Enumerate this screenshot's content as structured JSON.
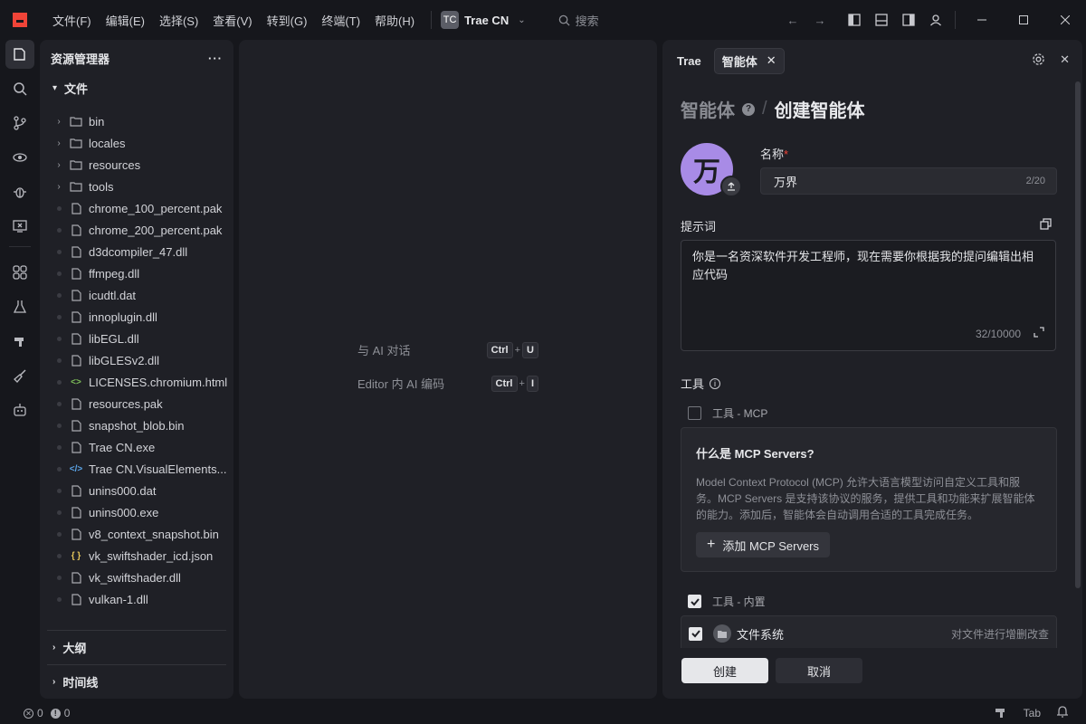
{
  "menu": [
    "文件(F)",
    "编辑(E)",
    "选择(S)",
    "查看(V)",
    "转到(G)",
    "终端(T)",
    "帮助(H)"
  ],
  "project": {
    "badge": "TC",
    "name": "Trae CN"
  },
  "search": {
    "placeholder": "搜索"
  },
  "explorer": {
    "title": "资源管理器",
    "more": "···",
    "folder": "文件",
    "folders": [
      "bin",
      "locales",
      "resources",
      "tools"
    ],
    "files": [
      {
        "name": "chrome_100_percent.pak",
        "icon": "file-icon"
      },
      {
        "name": "chrome_200_percent.pak",
        "icon": "file-icon"
      },
      {
        "name": "d3dcompiler_47.dll",
        "icon": "file-icon"
      },
      {
        "name": "ffmpeg.dll",
        "icon": "file-icon"
      },
      {
        "name": "icudtl.dat",
        "icon": "file-icon"
      },
      {
        "name": "innoplugin.dll",
        "icon": "file-icon"
      },
      {
        "name": "libEGL.dll",
        "icon": "file-icon"
      },
      {
        "name": "libGLESv2.dll",
        "icon": "file-icon"
      },
      {
        "name": "LICENSES.chromium.html",
        "icon": "html-icon"
      },
      {
        "name": "resources.pak",
        "icon": "file-icon"
      },
      {
        "name": "snapshot_blob.bin",
        "icon": "file-icon"
      },
      {
        "name": "Trae CN.exe",
        "icon": "file-icon"
      },
      {
        "name": "Trae CN.VisualElements...",
        "icon": "xml-icon"
      },
      {
        "name": "unins000.dat",
        "icon": "file-icon"
      },
      {
        "name": "unins000.exe",
        "icon": "file-icon"
      },
      {
        "name": "v8_context_snapshot.bin",
        "icon": "file-icon"
      },
      {
        "name": "vk_swiftshader_icd.json",
        "icon": "json-icon"
      },
      {
        "name": "vk_swiftshader.dll",
        "icon": "file-icon"
      },
      {
        "name": "vulkan-1.dll",
        "icon": "file-icon"
      }
    ],
    "outline": "大纲",
    "timeline": "时间线"
  },
  "editor": {
    "hints": [
      {
        "label": "与 AI 对话",
        "keys": [
          "Ctrl",
          "U"
        ]
      },
      {
        "label": "Editor 内 AI 编码",
        "keys": [
          "Ctrl",
          "I"
        ]
      }
    ],
    "plus": "+"
  },
  "panel": {
    "tab_trae": "Trae",
    "tab_agent": "智能体",
    "crumb_parent": "智能体",
    "crumb_sep": "/",
    "crumb_current": "创建智能体",
    "avatar_char": "万",
    "name_label": "名称",
    "name_required": "*",
    "name_value": "万界",
    "name_count": "2/20",
    "prompt_label": "提示词",
    "prompt_value": "你是一名资深软件开发工程师，现在需要你根据我的提问编辑出相应代码",
    "prompt_count": "32/10000",
    "tools_label": "工具",
    "mcp_check_label": "工具 - MCP",
    "mcp_title": "什么是 MCP Servers?",
    "mcp_desc": "Model Context Protocol (MCP) 允许大语言模型访问自定义工具和服务。MCP Servers 是支持该协议的服务，提供工具和功能来扩展智能体的能力。添加后，智能体会自动调用合适的工具完成任务。",
    "mcp_add": "添加 MCP Servers",
    "builtin_label": "工具 - 内置",
    "fs_name": "文件系统",
    "fs_desc": "对文件进行增删改查",
    "create_btn": "创建",
    "cancel_btn": "取消"
  },
  "status": {
    "errors": "0",
    "warnings": "0",
    "tab": "Tab"
  }
}
